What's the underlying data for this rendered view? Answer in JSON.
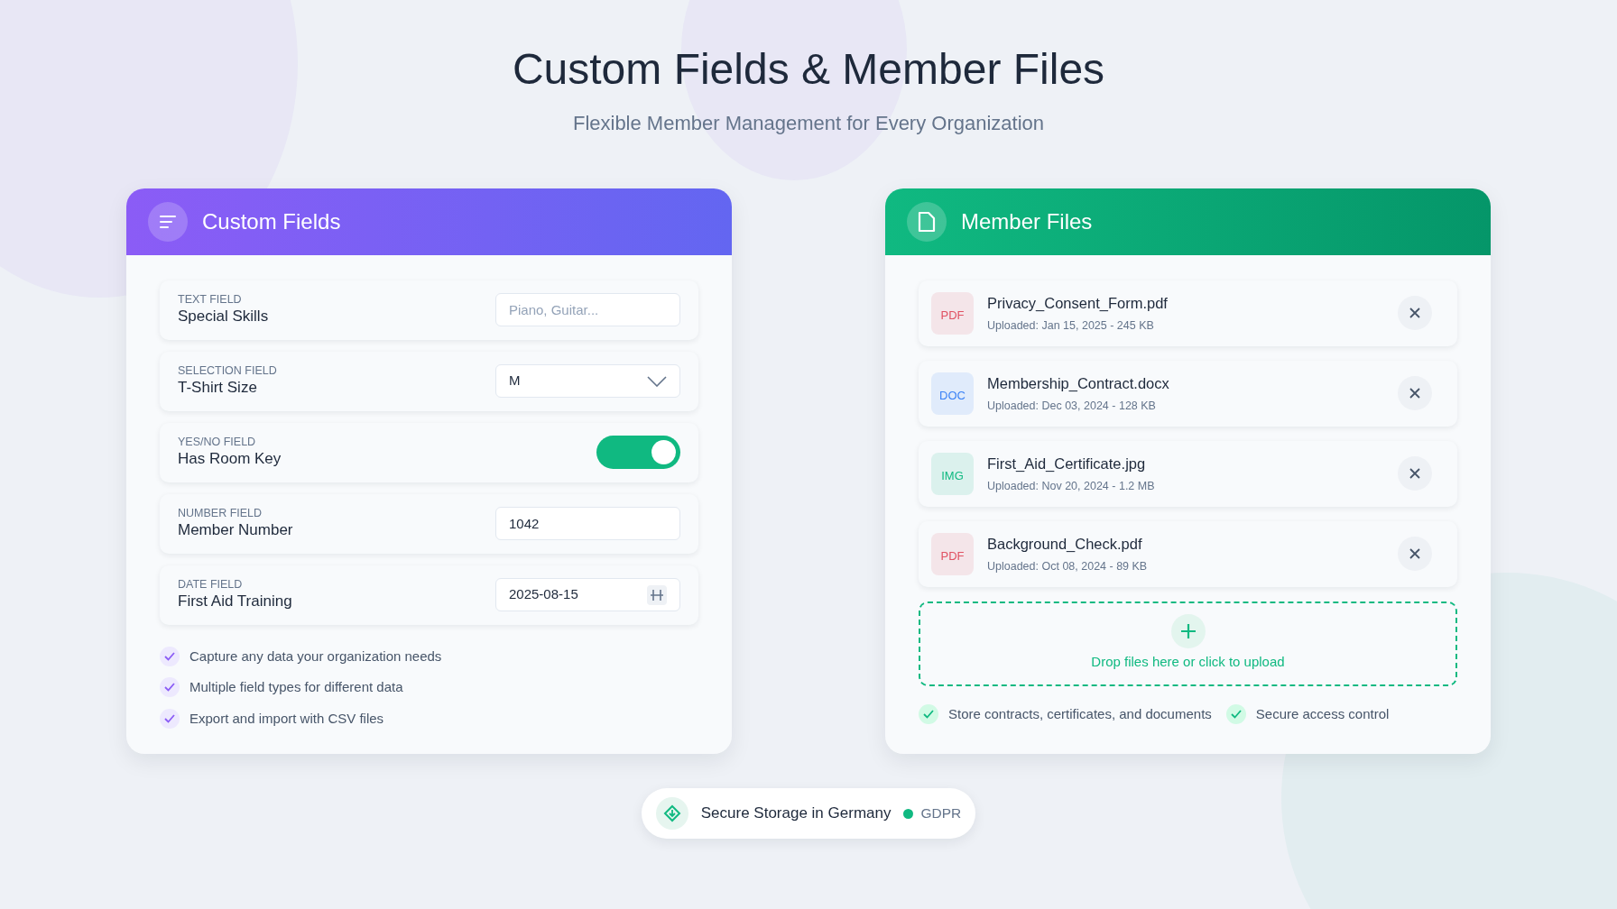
{
  "title": "Custom Fields & Member Files",
  "subtitle": "Flexible Member Management for Every Organization",
  "custom_fields": {
    "title": "Custom Fields",
    "fields": [
      {
        "kind": "text",
        "type_label": "TEXT FIELD",
        "name": "Special Skills",
        "placeholder": "Piano, Guitar..."
      },
      {
        "kind": "select",
        "type_label": "SELECTION FIELD",
        "name": "T-Shirt Size",
        "value": "M"
      },
      {
        "kind": "toggle",
        "type_label": "YES/NO FIELD",
        "name": "Has Room Key",
        "on": true
      },
      {
        "kind": "number",
        "type_label": "NUMBER FIELD",
        "name": "Member Number",
        "value": "1042"
      },
      {
        "kind": "date",
        "type_label": "DATE FIELD",
        "name": "First Aid Training",
        "value": "2025-08-15"
      }
    ],
    "features": [
      "Capture any data your organization needs",
      "Multiple field types for different data",
      "Export and import with CSV files"
    ]
  },
  "member_files": {
    "title": "Member Files",
    "files": [
      {
        "type": "PDF",
        "color": "#e05263",
        "name": "Privacy_Consent_Form.pdf",
        "meta": "Uploaded: Jan 15, 2025 - 245 KB"
      },
      {
        "type": "DOC",
        "color": "#3b82f6",
        "name": "Membership_Contract.docx",
        "meta": "Uploaded: Dec 03, 2024 - 128 KB"
      },
      {
        "type": "IMG",
        "color": "#10b981",
        "name": "First_Aid_Certificate.jpg",
        "meta": "Uploaded: Nov 20, 2024 - 1.2 MB"
      },
      {
        "type": "PDF",
        "color": "#e05263",
        "name": "Background_Check.pdf",
        "meta": "Uploaded: Oct 08, 2024 - 89 KB"
      }
    ],
    "upload_text": "Drop files here or click to upload",
    "features": [
      "Store contracts, certificates, and documents",
      "Secure access control"
    ]
  },
  "footer": {
    "text": "Secure Storage in Germany",
    "badge": "GDPR"
  }
}
